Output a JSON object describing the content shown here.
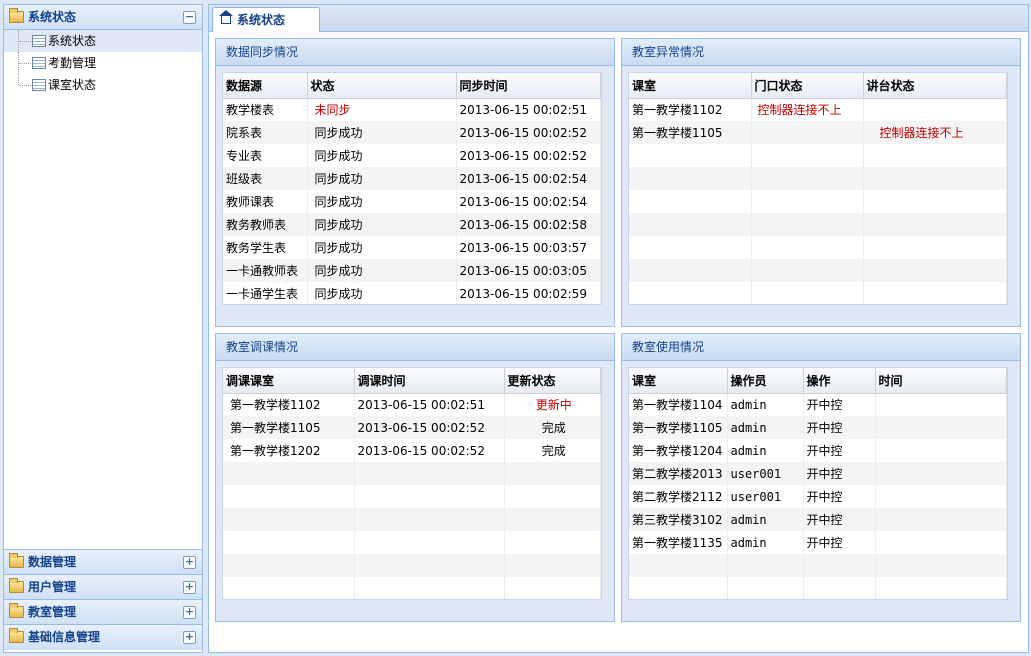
{
  "sidebar": {
    "active_section": "系统状态",
    "items": [
      "系统状态",
      "考勤管理",
      "课室状态"
    ],
    "sections": [
      "数据管理",
      "用户管理",
      "教室管理",
      "基础信息管理"
    ]
  },
  "tab": {
    "label": "系统状态"
  },
  "sync_panel": {
    "title": "数据同步情况",
    "headers": [
      "数据源",
      "状态",
      "同步时间"
    ],
    "rows": [
      [
        "教学楼表",
        "未同步",
        "2013-06-15 00:02:51"
      ],
      [
        "院系表",
        "同步成功",
        "2013-06-15 00:02:52"
      ],
      [
        "专业表",
        "同步成功",
        "2013-06-15 00:02:52"
      ],
      [
        "班级表",
        "同步成功",
        "2013-06-15 00:02:54"
      ],
      [
        "教师课表",
        "同步成功",
        "2013-06-15 00:02:54"
      ],
      [
        "教务教师表",
        "同步成功",
        "2013-06-15 00:02:58"
      ],
      [
        "教务学生表",
        "同步成功",
        "2013-06-15 00:03:57"
      ],
      [
        "一卡通教师表",
        "同步成功",
        "2013-06-15 00:03:05"
      ],
      [
        "一卡通学生表",
        "同步成功",
        "2013-06-15 00:02:59"
      ]
    ]
  },
  "abnormal_panel": {
    "title": "教室异常情况",
    "headers": [
      "课室",
      "门口状态",
      "讲台状态"
    ],
    "rows": [
      [
        "第一教学楼1102",
        "控制器连接不上",
        ""
      ],
      [
        "第一教学楼1105",
        "",
        "控制器连接不上"
      ]
    ]
  },
  "adjust_panel": {
    "title": "教室调课情况",
    "headers": [
      "调课课室",
      "调课时间",
      "更新状态"
    ],
    "rows": [
      [
        "第一教学楼1102",
        "2013-06-15 00:02:51",
        "更新中"
      ],
      [
        "第一教学楼1105",
        "2013-06-15 00:02:52",
        "完成"
      ],
      [
        "第一教学楼1202",
        "2013-06-15 00:02:52",
        "完成"
      ]
    ]
  },
  "usage_panel": {
    "title": "教室使用情况",
    "headers": [
      "课室",
      "操作员",
      "操作",
      "时间"
    ],
    "rows": [
      [
        "第一教学楼1104",
        "admin",
        "开中控",
        ""
      ],
      [
        "第一教学楼1105",
        "admin",
        "开中控",
        ""
      ],
      [
        "第一教学楼1204",
        "admin",
        "开中控",
        ""
      ],
      [
        "第二教学楼2013",
        "user001",
        "开中控",
        ""
      ],
      [
        "第二教学楼2112",
        "user001",
        "开中控",
        ""
      ],
      [
        "第三教学楼3102",
        "admin",
        "开中控",
        ""
      ],
      [
        "第一教学楼1135",
        "admin",
        "开中控",
        ""
      ]
    ]
  }
}
